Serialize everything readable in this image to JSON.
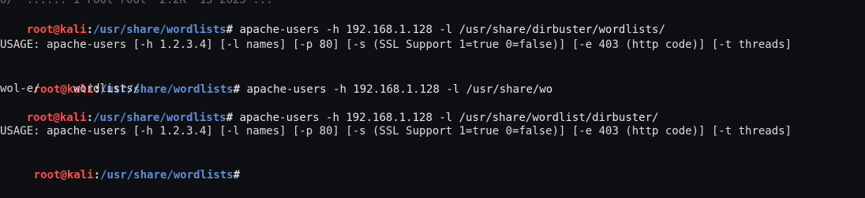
{
  "top_cutoff_line": "o/  ...... 1 root root  2.2K  15 2025 ...",
  "lines": {
    "l1": {
      "user": "root@kali",
      "sep": ":",
      "path": "/usr/share/wordlists",
      "hash": "#",
      "cmd": " apache-users -h 192.168.1.128 -l /usr/share/dirbuster/wordlists/"
    },
    "l2": "USAGE: apache-users [-h 1.2.3.4] [-l names] [-p 80] [-s (SSL Support 1=true 0=false)] [-e 403 (http code)] [-t threads]",
    "l3": {
      "user": "root@kali",
      "sep": ":",
      "path": "/usr/share/wordlists",
      "hash": "#",
      "cmd": " apache-users -h 192.168.1.128 -l /usr/share/wo"
    },
    "l4": "wol-e/     wordlists/",
    "l5": {
      "user": "root@kali",
      "sep": ":",
      "path": "/usr/share/wordlists",
      "hash": "#",
      "cmd": " apache-users -h 192.168.1.128 -l /usr/share/wordlist/dirbuster/"
    },
    "l6": "USAGE: apache-users [-h 1.2.3.4] [-l names] [-p 80] [-s (SSL Support 1=true 0=false)] [-e 403 (http code)] [-t threads]",
    "l7": {
      "user": "root@kali",
      "sep": ":",
      "path": "/usr/share/wordlists",
      "hash": "#",
      "cmd": ""
    }
  },
  "colors": {
    "background": "#0e0f12",
    "prompt_user": "#ff4d4d",
    "prompt_path": "#5f8ed8",
    "text": "#dcdcdc"
  }
}
